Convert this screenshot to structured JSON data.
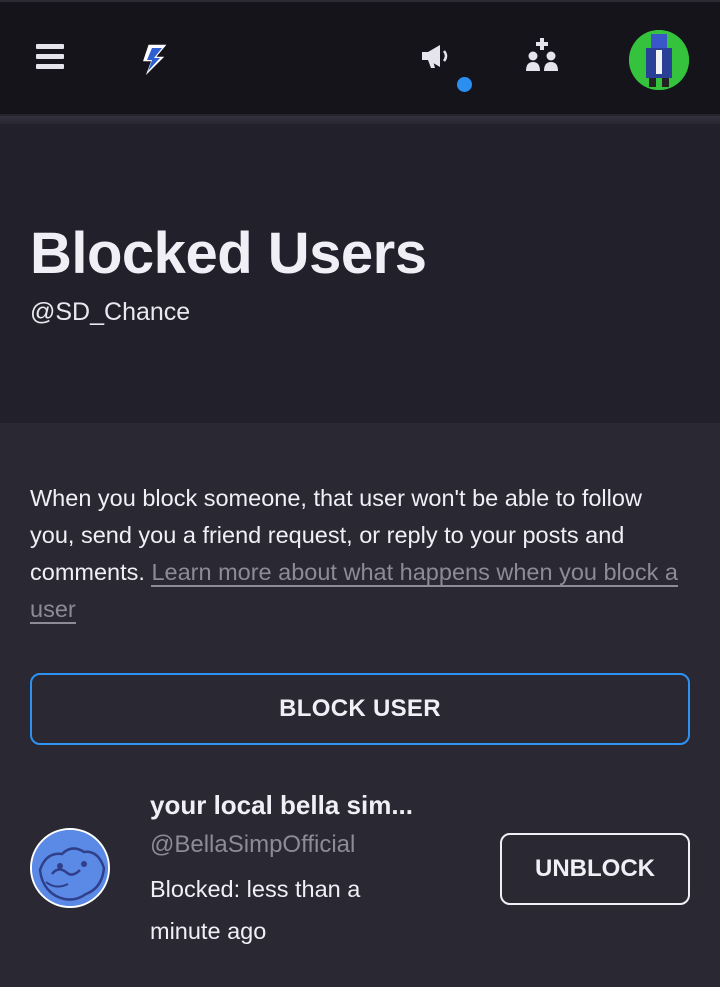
{
  "nav": {
    "menu_icon": "hamburger-menu-icon",
    "logo_icon": "lightning-bolt-logo-icon",
    "notifications_icon": "megaphone-icon",
    "friends_icon": "add-friend-icon",
    "notification_dot_color": "#2b8ff1"
  },
  "header": {
    "title": "Blocked Users",
    "handle": "@SD_Chance"
  },
  "description": {
    "text": "When you block someone, that user won't be able to follow you, send you a friend request, or reply to your posts and comments. ",
    "link": "Learn more about what happens when you block a user"
  },
  "actions": {
    "block_user_label": "BLOCK USER",
    "accent_color": "#2d92f2"
  },
  "blocked_users": [
    {
      "name": "your local bella sim...",
      "handle": "@BellaSimpOfficial",
      "blocked_text": "Blocked: less than a minute ago",
      "unblock_label": "UNBLOCK"
    }
  ]
}
